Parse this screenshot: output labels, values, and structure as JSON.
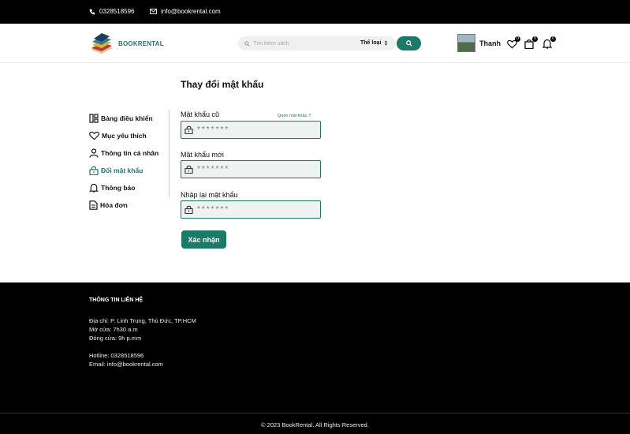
{
  "topbar": {
    "phone": "0328518596",
    "email": "info@bookrental.com"
  },
  "header": {
    "logo_text": "BOOKRENTAL",
    "search_placeholder": "Tìm kiếm sách",
    "category_label": "Thể loại",
    "username": "Thanh",
    "wishlist_count": "0",
    "cart_count": "0",
    "notification_count": "0"
  },
  "page": {
    "title": "Thay đổi mật khẩu"
  },
  "sidebar": {
    "items": [
      {
        "label": "Bảng điều khiển",
        "icon": "dashboard-icon"
      },
      {
        "label": "Mục yêu thích",
        "icon": "heart-icon"
      },
      {
        "label": "Thông tin cá nhân",
        "icon": "user-icon"
      },
      {
        "label": "Đổi mật khẩu",
        "icon": "lock-icon",
        "active": true
      },
      {
        "label": "Thông báo",
        "icon": "bell-icon"
      },
      {
        "label": "Hóa đơn",
        "icon": "invoice-icon"
      }
    ]
  },
  "form": {
    "old_label": "Mật khẩu cũ",
    "forgot_label": "Quên mật khẩu ?",
    "new_label": "Mật khẩu mới",
    "confirm_label": "Nhập lại mật khẩu",
    "placeholder": "*******",
    "submit_label": "Xác nhận"
  },
  "footer": {
    "title": "THÔNG TIN LIÊN HỆ",
    "address": "Địa chỉ: P. Linh Trung, Thủ Đức, TP.HCM",
    "open": "Mở cửa: 7h30 a.m",
    "close": "Đóng cửa: 9h p.mm",
    "hotline": "Hotline: 0328518596",
    "email": "Email: info@bookrental.com",
    "copyright": "© 2023 BookRental. All Rights Reserved."
  },
  "colors": {
    "accent": "#1b7a68",
    "dark": "#000000"
  }
}
